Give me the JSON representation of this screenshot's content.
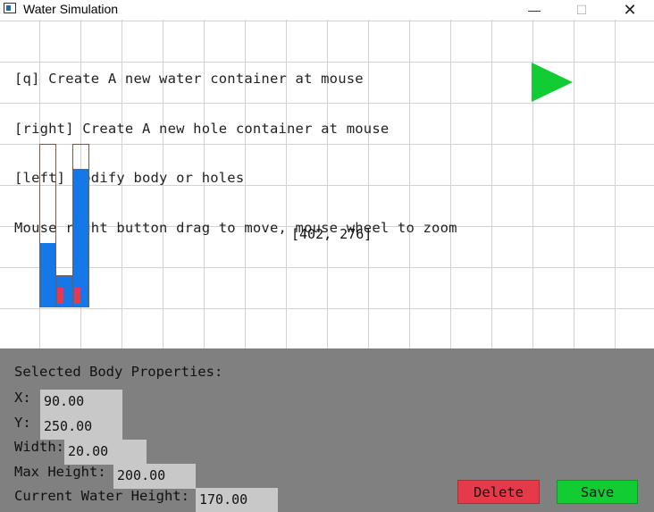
{
  "window": {
    "title": "Water Simulation",
    "minimize_glyph": "—",
    "maximize_glyph": "☐",
    "close_glyph": "✕"
  },
  "instructions": [
    "[q] Create A new water container at mouse",
    "[right] Create A new hole container at mouse",
    "[left] modify body or holes",
    "Mouse right button drag to move, mouse wheel to zoom"
  ],
  "play_icon": "play-icon",
  "mouse_coords": "[402, 276]",
  "colors": {
    "water": "#1478e8",
    "hole": "#e63a4a",
    "play": "#11cc33",
    "panel": "#808080",
    "field": "#c8c8c8",
    "delete": "#e63a4a",
    "save": "#11cc33"
  },
  "panel": {
    "title": "Selected Body Properties:",
    "fields": {
      "x": {
        "label": "X:",
        "value": "90.00"
      },
      "y": {
        "label": "Y:",
        "value": "250.00"
      },
      "width": {
        "label": "Width:",
        "value": "20.00"
      },
      "max_height": {
        "label": "Max Height:",
        "value": "200.00"
      },
      "current_water_height": {
        "label": "Current Water Height:",
        "value": "170.00"
      }
    },
    "delete_label": "Delete",
    "save_label": "Save"
  }
}
